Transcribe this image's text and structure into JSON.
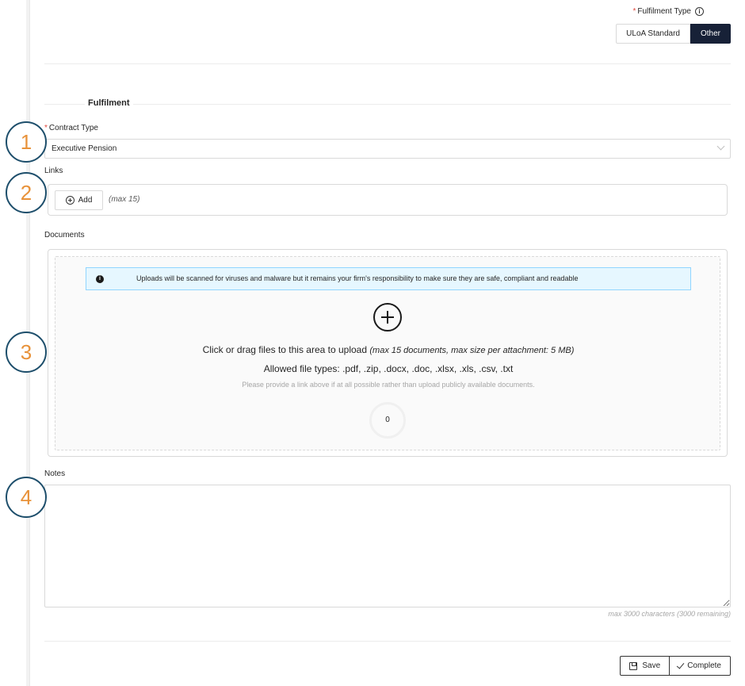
{
  "fulfilment_type": {
    "label": "Fulfilment Type",
    "options": [
      "ULoA Standard",
      "Other"
    ],
    "selected": "Other"
  },
  "section": {
    "title": "Fulfilment"
  },
  "contract_type": {
    "label": "Contract Type",
    "value": "Executive Pension"
  },
  "links": {
    "label": "Links",
    "add_label": "Add",
    "max_note": "(max 15)"
  },
  "documents": {
    "label": "Documents",
    "alert": "Uploads will be scanned for viruses and malware but it remains your firm's responsibility to make sure they are safe, compliant and readable",
    "upload_main": "Click or drag files to this area to upload",
    "upload_limits": "(max 15 documents, max size per attachment: 5 MB)",
    "allowed_types": "Allowed file types: .pdf, .zip, .docx, .doc, .xlsx, .xls, .csv, .txt",
    "hint": "Please provide a link above if at all possible rather than upload publicly available documents.",
    "count": "0"
  },
  "notes": {
    "label": "Notes",
    "value": "",
    "char_count": "max 3000 characters (3000 remaining)"
  },
  "actions": {
    "save_label": "Save",
    "complete_label": "Complete"
  },
  "callouts": [
    "1",
    "2",
    "3",
    "4"
  ]
}
